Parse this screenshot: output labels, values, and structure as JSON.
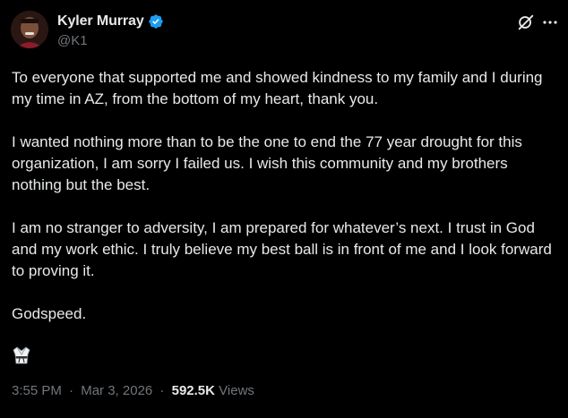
{
  "author": {
    "display_name": "Kyler Murray",
    "handle": "@K1",
    "verified": true,
    "verified_color": "#1d9bf0",
    "avatar_icon": "profile-photo"
  },
  "actions": {
    "grok_icon": "grok-icon",
    "more_icon": "more-horizontal-icon"
  },
  "tweet": {
    "paragraphs": [
      "To everyone that supported me and showed kindness to my family and I during my time in AZ, from the bottom of my heart, thank you.",
      "I wanted nothing more than to be the one to end the 77 year drought for this organization, I am sorry I failed us. I wish this community and my brothers nothing but the best.",
      "I am no stranger to adversity, I am prepared for whatever’s next. I trust in God and my work ethic. I truly believe my best ball is in front of me and I look forward to proving it.",
      "Godspeed."
    ],
    "emoji": "martial-arts-uniform-emoji"
  },
  "meta": {
    "time": "3:55 PM",
    "separator": "·",
    "date": "Mar 3, 2026",
    "views_count": "592.5K",
    "views_label": "Views"
  },
  "colors": {
    "background": "#000000",
    "text": "#e7e9ea",
    "secondary_text": "#71767b"
  }
}
